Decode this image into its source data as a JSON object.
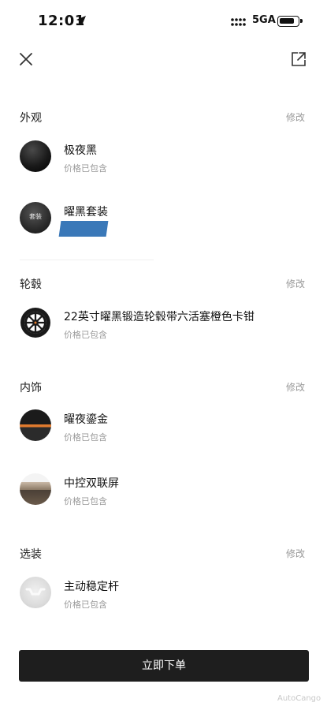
{
  "status_bar": {
    "time": "12:01",
    "network": "5GA",
    "battery_level": 0.85
  },
  "nav": {
    "close_icon": "close-icon",
    "share_icon": "share-icon"
  },
  "sections": {
    "exterior": {
      "title": "外观",
      "edit": "修改"
    },
    "wheels": {
      "title": "轮毂",
      "edit": "修改"
    },
    "interior": {
      "title": "内饰",
      "edit": "修改"
    },
    "options": {
      "title": "选装",
      "edit": "修改"
    }
  },
  "items": {
    "color": {
      "name": "极夜黑",
      "price": "价格已包含"
    },
    "suite": {
      "name": "曜黑套装",
      "thumb_label": "套装"
    },
    "wheel": {
      "name": "22英寸曜黑锻造轮毂带六活塞橙色卡钳",
      "price": "价格已包含"
    },
    "interior_color": {
      "name": "曜夜鎏金",
      "price": "价格已包含"
    },
    "screen": {
      "name": "中控双联屏",
      "price": "价格已包含"
    },
    "stabilizer": {
      "name": "主动稳定杆",
      "price": "价格已包含"
    }
  },
  "footer": {
    "order_button": "立即下单",
    "watermark": "AutoCango"
  },
  "colors": {
    "accent": "#1e1e1e",
    "muted": "#999999",
    "redaction": "#3a78b8",
    "caliper": "#e07a2e"
  }
}
